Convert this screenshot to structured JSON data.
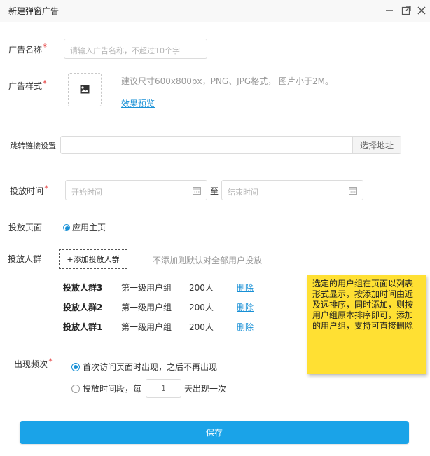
{
  "window": {
    "title": "新建弹窗广告",
    "controls": [
      "minimize-icon",
      "maximize-icon",
      "close-icon"
    ]
  },
  "form": {
    "ad_name": {
      "label": "广告名称",
      "required_mark": "*",
      "placeholder": "请输入广告名称，不超过10个字"
    },
    "ad_style": {
      "label": "广告样式",
      "required_mark": "*",
      "upload_icon": "image-icon",
      "hint": "建议尺寸600x800px，PNG、JPG格式， 图片小于2M。",
      "preview_link": "效果预览"
    },
    "jump_link": {
      "label": "跳转链接设置",
      "value": "",
      "select_button": "选择地址"
    },
    "schedule": {
      "label": "投放时间",
      "required_mark": "*",
      "start_placeholder": "开始时间",
      "separator": "至",
      "end_placeholder": "结束时间"
    },
    "page": {
      "label": "投放页面",
      "option": "应用主页",
      "selected": true
    },
    "audience": {
      "label": "投放人群",
      "add_button": "+添加投放人群",
      "hint": "不添加则默认对全部用户投放",
      "groups": [
        {
          "name": "投放人群3",
          "level": "第一级用户组",
          "count": "200人",
          "action": "删除"
        },
        {
          "name": "投放人群2",
          "level": "第一级用户组",
          "count": "200人",
          "action": "删除"
        },
        {
          "name": "投放人群1",
          "level": "第一级用户组",
          "count": "200人",
          "action": "删除"
        }
      ]
    },
    "frequency": {
      "label": "出现频次",
      "required_mark": "*",
      "option1": "首次访问页面时出现，之后不再出现",
      "option1_selected": true,
      "option2_prefix": "投放时间段，每",
      "option2_value": "1",
      "option2_suffix": "天出现一次",
      "option2_selected": false
    },
    "save_button": "保存"
  },
  "annotation": {
    "text": "选定的用户组在页面以列表形式显示，按添加时间由近及远排序，同时添加，则按用户组原本排序即可，添加的用户组，支持可直接删除"
  },
  "colors": {
    "accent": "#1890d6",
    "save_button": "#1aa3e8",
    "required": "#e64545",
    "sticky_note": "#ffe033"
  }
}
